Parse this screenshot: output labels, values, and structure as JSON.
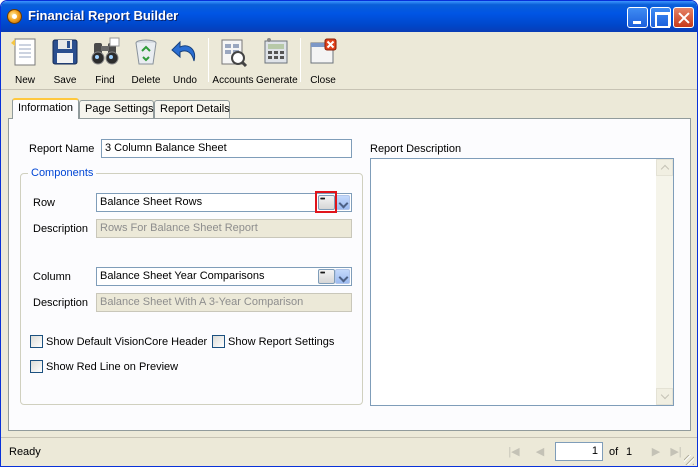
{
  "window": {
    "title": "Financial Report Builder"
  },
  "toolbar": {
    "items": [
      {
        "label": "New",
        "icon": "new-document-icon"
      },
      {
        "label": "Save",
        "icon": "floppy-disk-icon"
      },
      {
        "label": "Find",
        "icon": "binoculars-icon"
      },
      {
        "label": "Delete",
        "icon": "recycle-bin-icon"
      },
      {
        "label": "Undo",
        "icon": "undo-arrow-icon"
      },
      {
        "label": "Accounts",
        "icon": "accounts-icon"
      },
      {
        "label": "Generate",
        "icon": "calculator-icon"
      },
      {
        "label": "Close",
        "icon": "close-window-icon"
      }
    ]
  },
  "tabs": [
    {
      "label": "Information",
      "active": true
    },
    {
      "label": "Page Settings",
      "active": false
    },
    {
      "label": "Report Details",
      "active": false
    }
  ],
  "form": {
    "report_name_label": "Report Name",
    "report_name_value": "3 Column Balance Sheet",
    "components_label": "Components",
    "row_label": "Row",
    "row_value": "Balance Sheet Rows",
    "row_description_label": "Description",
    "row_description_value": "Rows For Balance Sheet Report",
    "column_label": "Column",
    "column_value": "Balance Sheet Year Comparisons",
    "column_description_label": "Description",
    "column_description_value": "Balance Sheet With A 3-Year Comparison",
    "show_header_label": "Show Default VisionCore Header",
    "show_settings_label": "Show Report Settings",
    "show_red_line_label": "Show Red Line on Preview",
    "report_description_label": "Report Description"
  },
  "statusbar": {
    "status": "Ready",
    "page_current": "1",
    "page_of": "of",
    "page_total": "1"
  },
  "colors": {
    "titlebar": "#0055e5",
    "highlight": "#e0141b",
    "group_title": "#0046d5"
  }
}
